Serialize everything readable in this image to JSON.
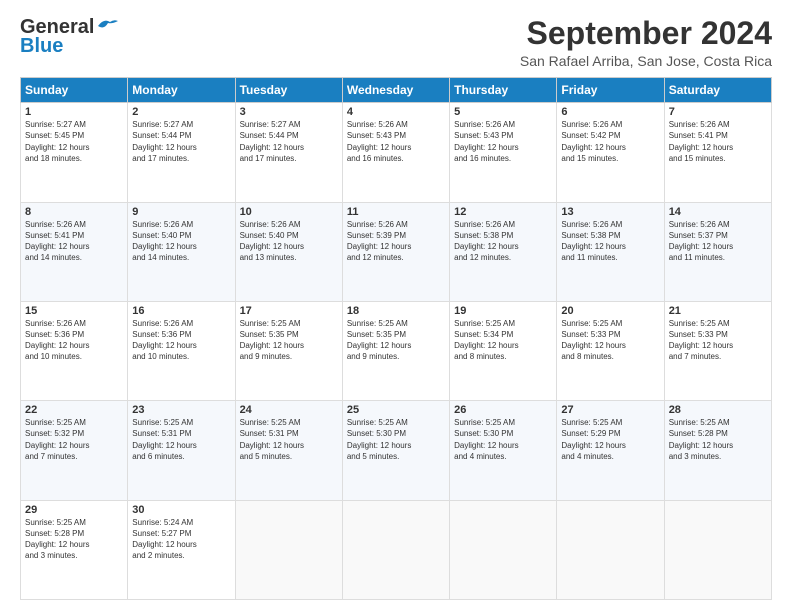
{
  "logo": {
    "line1": "General",
    "line2": "Blue"
  },
  "title": "September 2024",
  "subtitle": "San Rafael Arriba, San Jose, Costa Rica",
  "days_header": [
    "Sunday",
    "Monday",
    "Tuesday",
    "Wednesday",
    "Thursday",
    "Friday",
    "Saturday"
  ],
  "weeks": [
    [
      {
        "day": "1",
        "info": "Sunrise: 5:27 AM\nSunset: 5:45 PM\nDaylight: 12 hours\nand 18 minutes."
      },
      {
        "day": "2",
        "info": "Sunrise: 5:27 AM\nSunset: 5:44 PM\nDaylight: 12 hours\nand 17 minutes."
      },
      {
        "day": "3",
        "info": "Sunrise: 5:27 AM\nSunset: 5:44 PM\nDaylight: 12 hours\nand 17 minutes."
      },
      {
        "day": "4",
        "info": "Sunrise: 5:26 AM\nSunset: 5:43 PM\nDaylight: 12 hours\nand 16 minutes."
      },
      {
        "day": "5",
        "info": "Sunrise: 5:26 AM\nSunset: 5:43 PM\nDaylight: 12 hours\nand 16 minutes."
      },
      {
        "day": "6",
        "info": "Sunrise: 5:26 AM\nSunset: 5:42 PM\nDaylight: 12 hours\nand 15 minutes."
      },
      {
        "day": "7",
        "info": "Sunrise: 5:26 AM\nSunset: 5:41 PM\nDaylight: 12 hours\nand 15 minutes."
      }
    ],
    [
      {
        "day": "8",
        "info": "Sunrise: 5:26 AM\nSunset: 5:41 PM\nDaylight: 12 hours\nand 14 minutes."
      },
      {
        "day": "9",
        "info": "Sunrise: 5:26 AM\nSunset: 5:40 PM\nDaylight: 12 hours\nand 14 minutes."
      },
      {
        "day": "10",
        "info": "Sunrise: 5:26 AM\nSunset: 5:40 PM\nDaylight: 12 hours\nand 13 minutes."
      },
      {
        "day": "11",
        "info": "Sunrise: 5:26 AM\nSunset: 5:39 PM\nDaylight: 12 hours\nand 12 minutes."
      },
      {
        "day": "12",
        "info": "Sunrise: 5:26 AM\nSunset: 5:38 PM\nDaylight: 12 hours\nand 12 minutes."
      },
      {
        "day": "13",
        "info": "Sunrise: 5:26 AM\nSunset: 5:38 PM\nDaylight: 12 hours\nand 11 minutes."
      },
      {
        "day": "14",
        "info": "Sunrise: 5:26 AM\nSunset: 5:37 PM\nDaylight: 12 hours\nand 11 minutes."
      }
    ],
    [
      {
        "day": "15",
        "info": "Sunrise: 5:26 AM\nSunset: 5:36 PM\nDaylight: 12 hours\nand 10 minutes."
      },
      {
        "day": "16",
        "info": "Sunrise: 5:26 AM\nSunset: 5:36 PM\nDaylight: 12 hours\nand 10 minutes."
      },
      {
        "day": "17",
        "info": "Sunrise: 5:25 AM\nSunset: 5:35 PM\nDaylight: 12 hours\nand 9 minutes."
      },
      {
        "day": "18",
        "info": "Sunrise: 5:25 AM\nSunset: 5:35 PM\nDaylight: 12 hours\nand 9 minutes."
      },
      {
        "day": "19",
        "info": "Sunrise: 5:25 AM\nSunset: 5:34 PM\nDaylight: 12 hours\nand 8 minutes."
      },
      {
        "day": "20",
        "info": "Sunrise: 5:25 AM\nSunset: 5:33 PM\nDaylight: 12 hours\nand 8 minutes."
      },
      {
        "day": "21",
        "info": "Sunrise: 5:25 AM\nSunset: 5:33 PM\nDaylight: 12 hours\nand 7 minutes."
      }
    ],
    [
      {
        "day": "22",
        "info": "Sunrise: 5:25 AM\nSunset: 5:32 PM\nDaylight: 12 hours\nand 7 minutes."
      },
      {
        "day": "23",
        "info": "Sunrise: 5:25 AM\nSunset: 5:31 PM\nDaylight: 12 hours\nand 6 minutes."
      },
      {
        "day": "24",
        "info": "Sunrise: 5:25 AM\nSunset: 5:31 PM\nDaylight: 12 hours\nand 5 minutes."
      },
      {
        "day": "25",
        "info": "Sunrise: 5:25 AM\nSunset: 5:30 PM\nDaylight: 12 hours\nand 5 minutes."
      },
      {
        "day": "26",
        "info": "Sunrise: 5:25 AM\nSunset: 5:30 PM\nDaylight: 12 hours\nand 4 minutes."
      },
      {
        "day": "27",
        "info": "Sunrise: 5:25 AM\nSunset: 5:29 PM\nDaylight: 12 hours\nand 4 minutes."
      },
      {
        "day": "28",
        "info": "Sunrise: 5:25 AM\nSunset: 5:28 PM\nDaylight: 12 hours\nand 3 minutes."
      }
    ],
    [
      {
        "day": "29",
        "info": "Sunrise: 5:25 AM\nSunset: 5:28 PM\nDaylight: 12 hours\nand 3 minutes."
      },
      {
        "day": "30",
        "info": "Sunrise: 5:24 AM\nSunset: 5:27 PM\nDaylight: 12 hours\nand 2 minutes."
      },
      null,
      null,
      null,
      null,
      null
    ]
  ]
}
